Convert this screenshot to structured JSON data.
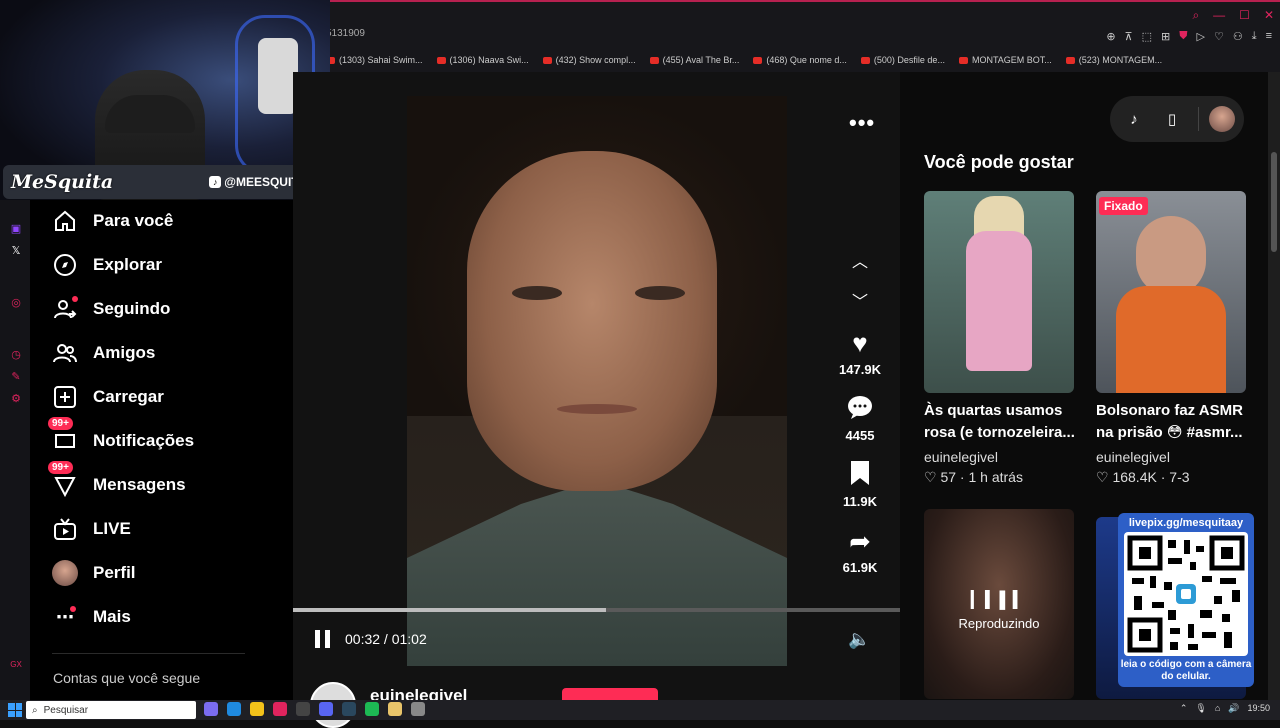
{
  "browser": {
    "url": "5131909",
    "bookmarks": [
      "(1303) Sahai Swim...",
      "(1306) Naava Swi...",
      "(432) Show compl...",
      "(455) Aval The Br...",
      "(468) Que nome d...",
      "(500) Desfile de...",
      "MONTAGEM BOT...",
      "(523) MONTAGEM..."
    ]
  },
  "stream_overlay": {
    "logo": "MeSquita",
    "handle": "@MEESQUIT_A"
  },
  "sidebar": {
    "items": [
      {
        "label": "Para você",
        "icon": "home-icon"
      },
      {
        "label": "Explorar",
        "icon": "compass-icon"
      },
      {
        "label": "Seguindo",
        "icon": "following-icon"
      },
      {
        "label": "Amigos",
        "icon": "friends-icon"
      },
      {
        "label": "Carregar",
        "icon": "upload-icon"
      },
      {
        "label": "Notificações",
        "icon": "inbox-icon",
        "badge": "99+"
      },
      {
        "label": "Mensagens",
        "icon": "messages-icon",
        "badge": "99+"
      },
      {
        "label": "LIVE",
        "icon": "live-icon"
      },
      {
        "label": "Perfil",
        "icon": "profile-avatar"
      },
      {
        "label": "Mais",
        "icon": "more-dots-icon"
      }
    ],
    "following_heading": "Contas que você segue"
  },
  "player": {
    "time": "00:32 / 01:02",
    "progress_fraction": 0.516,
    "username": "euinelegivel"
  },
  "actions": {
    "likes": "147.9K",
    "comments": "4455",
    "saves": "11.9K",
    "shares": "61.9K"
  },
  "recommendations": {
    "title": "Você pode gostar",
    "cards": [
      {
        "title": "Às quartas usamos rosa (e tornozeleira...",
        "user": "euinelegivel",
        "likes": "57",
        "time": "1 h atrás",
        "colors": [
          "#6a8f86",
          "#e7a6c4"
        ]
      },
      {
        "title": "Bolsonaro faz ASMR na prisão 😳 #asmr...",
        "user": "euinelegivel",
        "likes": "168.4K",
        "time": "7-3",
        "badge": "Fixado",
        "colors": [
          "#8a8f96",
          "#e06a2a"
        ]
      }
    ],
    "playing_label": "Reproduzindo"
  },
  "qr_overlay": {
    "url": "livepix.gg/mesquitaay",
    "caption": "leia o código com a câmera do celular."
  },
  "taskbar": {
    "search_placeholder": "Pesquisar",
    "clock": "19:50"
  }
}
